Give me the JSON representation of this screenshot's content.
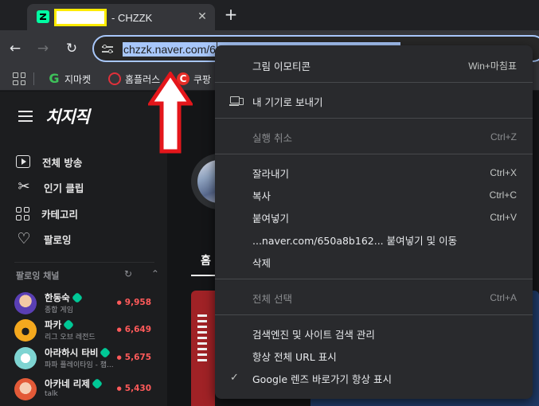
{
  "tab": {
    "title": "- CHZZK",
    "close": "✕",
    "new_tab": "+"
  },
  "toolbar": {
    "back": "←",
    "forward": "→",
    "reload": "↻",
    "url": "chzzk.naver.com/6"
  },
  "bookmarks": [
    {
      "label": "지마켓",
      "icon": "G"
    },
    {
      "label": "홈플러스",
      "icon": ""
    },
    {
      "label": "쿠팡",
      "icon": "C"
    }
  ],
  "page": {
    "logo": "치지직",
    "nav": [
      {
        "label": "전체 방송",
        "icon": "live-play-icon"
      },
      {
        "label": "인기 클립",
        "icon": "scissors-clip-icon"
      },
      {
        "label": "카테고리",
        "icon": "category-grid-icon"
      },
      {
        "label": "팔로잉",
        "icon": "heart-icon"
      }
    ],
    "following_header": "팔로잉 채널",
    "following_tools": "↻ ⌃",
    "following": [
      {
        "name": "한동숙",
        "sub": "종합 게임",
        "count": "9,958"
      },
      {
        "name": "파카",
        "sub": "리그 오브 레전드",
        "count": "6,649"
      },
      {
        "name": "아라하시 타비",
        "sub": "파파 플레이타임 - 챕...",
        "count": "5,675"
      },
      {
        "name": "아카네 리제",
        "sub": "talk",
        "count": "5,430"
      }
    ],
    "main_tab": "홈"
  },
  "context_menu": {
    "items": [
      {
        "label": "그림 이모티콘",
        "shortcut": "Win+마침표",
        "disabled": false
      },
      {
        "label": "내 기기로 보내기",
        "shortcut": "",
        "disabled": false
      },
      {
        "label": "실행 취소",
        "shortcut": "Ctrl+Z",
        "disabled": true
      },
      {
        "label": "잘라내기",
        "shortcut": "Ctrl+X",
        "disabled": false
      },
      {
        "label": "복사",
        "shortcut": "Ctrl+C",
        "disabled": false
      },
      {
        "label": "붙여넣기",
        "shortcut": "Ctrl+V",
        "disabled": false
      },
      {
        "label": "...naver.com/650a8b162... 붙여넣기 및 이동",
        "shortcut": "",
        "disabled": false
      },
      {
        "label": "삭제",
        "shortcut": "",
        "disabled": false
      },
      {
        "label": "전체 선택",
        "shortcut": "Ctrl+A",
        "disabled": true
      },
      {
        "label": "검색엔진 및 사이트 검색 관리",
        "shortcut": "",
        "disabled": false
      },
      {
        "label": "항상 전체 URL 표시",
        "shortcut": "",
        "disabled": false
      },
      {
        "label": "Google 렌즈 바로가기 항상 표시",
        "shortcut": "",
        "disabled": false,
        "checked": true
      }
    ]
  },
  "colors": {
    "accent_green": "#00ffa3",
    "live_red": "#ff5a5a",
    "selection_blue": "#a8c7fa",
    "annotation_red": "#e4161b"
  }
}
